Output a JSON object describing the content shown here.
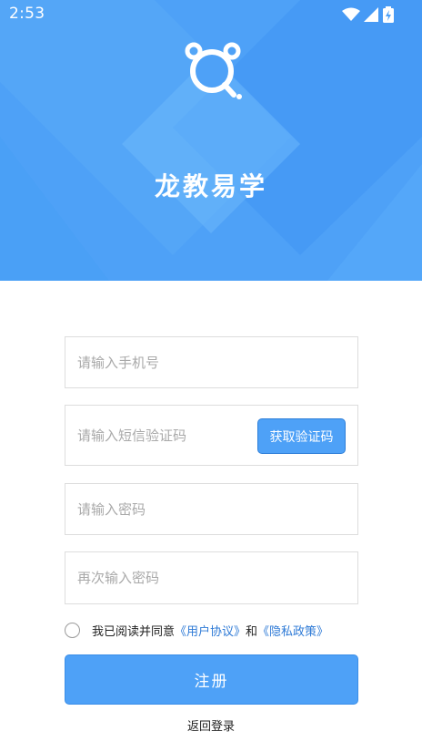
{
  "colors": {
    "brand": "#4ea1f7",
    "link": "#2e7ad6",
    "border": "#dddddd"
  },
  "status_bar": {
    "time": "2:53",
    "icons": [
      "wifi-icon",
      "signal-icon",
      "battery-icon"
    ]
  },
  "header": {
    "logo_icon": "search-bear-icon",
    "app_title": "龙教易学"
  },
  "form": {
    "phone_placeholder": "请输入手机号",
    "sms_code_placeholder": "请输入短信验证码",
    "get_code_label": "获取验证码",
    "password_placeholder": "请输入密码",
    "confirm_password_placeholder": "再次输入密码"
  },
  "agreement": {
    "prefix": "我已阅读并同意",
    "user_agreement": "《用户协议》",
    "conjunction": "和",
    "privacy_policy": "《隐私政策》",
    "checked": false
  },
  "submit_label": "注册",
  "back_to_login": "返回登录"
}
